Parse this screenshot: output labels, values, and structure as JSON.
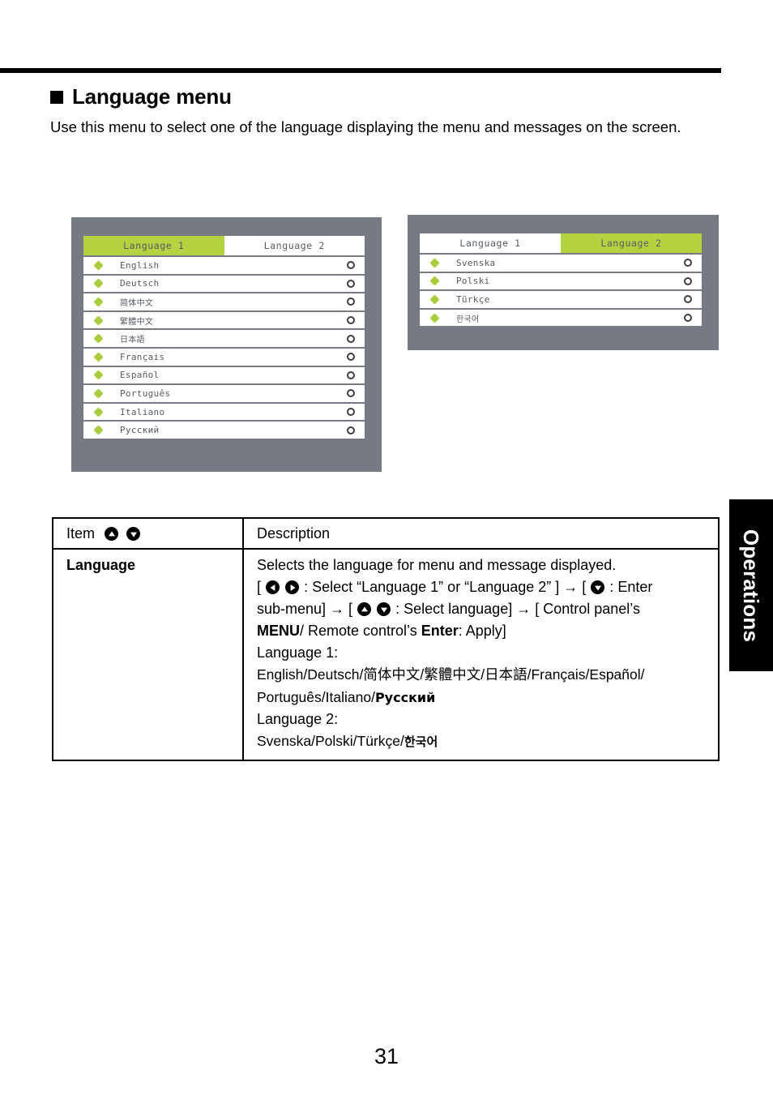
{
  "header": {
    "bullet_icon": "black-square-bullet",
    "title": "Language menu",
    "intro": "Use this menu to select one of the language displaying the menu and messages on the screen."
  },
  "osd_left": {
    "name": "language-1-osd",
    "tabs": [
      {
        "label": "Language 1",
        "active": true
      },
      {
        "label": "Language 2",
        "active": false
      }
    ],
    "rows": [
      {
        "label": "English",
        "script": "latin"
      },
      {
        "label": "Deutsch",
        "script": "latin"
      },
      {
        "label": "简体中文",
        "script": "cjk"
      },
      {
        "label": "繁體中文",
        "script": "cjk"
      },
      {
        "label": "日本語",
        "script": "cjk"
      },
      {
        "label": "Français",
        "script": "latin"
      },
      {
        "label": "Español",
        "script": "latin"
      },
      {
        "label": "Português",
        "script": "latin"
      },
      {
        "label": "Italiano",
        "script": "latin"
      },
      {
        "label": "Русский",
        "script": "latin"
      }
    ]
  },
  "osd_right": {
    "name": "language-2-osd",
    "tabs": [
      {
        "label": "Language 1",
        "active": false
      },
      {
        "label": "Language 2",
        "active": true
      }
    ],
    "rows": [
      {
        "label": "Svenska",
        "script": "latin"
      },
      {
        "label": "Polski",
        "script": "latin"
      },
      {
        "label": "Türkçe",
        "script": "latin"
      },
      {
        "label": "한국어",
        "script": "cjk"
      }
    ]
  },
  "table": {
    "headers": {
      "item": "Item",
      "description": "Description"
    },
    "row": {
      "item": "Language",
      "desc_line_1": "Selects the language for menu and message displayed.",
      "desc_line_2_a": "[",
      "desc_line_2_b": ": Select “Language 1” or “Language 2” ]",
      "desc_line_2_c": "→ [",
      "desc_line_2_d": ": Enter",
      "desc_line_3_a": "sub-menu] → [",
      "desc_line_3_b": ": Select language] → [ Control panel’s",
      "desc_line_4_a": "MENU",
      "desc_line_4_b": "/ Remote control’s",
      "desc_line_4_c": "Enter",
      "desc_line_4_d": ": Apply]",
      "lang1_label": "Language 1:",
      "lang1_list_a": "English/Deutsch/",
      "lang1_list_cjk": "简体中文",
      "lang1_list_b": "/",
      "lang1_list_cjk2": "繁體中文",
      "lang1_list_c": "/",
      "lang1_list_cjk3": "日本語",
      "lang1_list_d": "/Français/Español/",
      "lang1_list_e": "Português/Italiano/",
      "lang1_list_cyr": "Русский",
      "lang2_label": "Language 2:",
      "lang2_list_a": "Svenska/Polski/Türkçe/",
      "lang2_list_kor": "한국어"
    }
  },
  "side_tab": {
    "label": "Operations"
  },
  "footer": {
    "page_number": "31"
  },
  "colors": {
    "osd_background": "#767b83",
    "osd_accent_green": "#b5d340",
    "osd_bullet_green": "#a8cc3c",
    "osd_text": "#555b63",
    "side_tab_background": "#000000"
  }
}
